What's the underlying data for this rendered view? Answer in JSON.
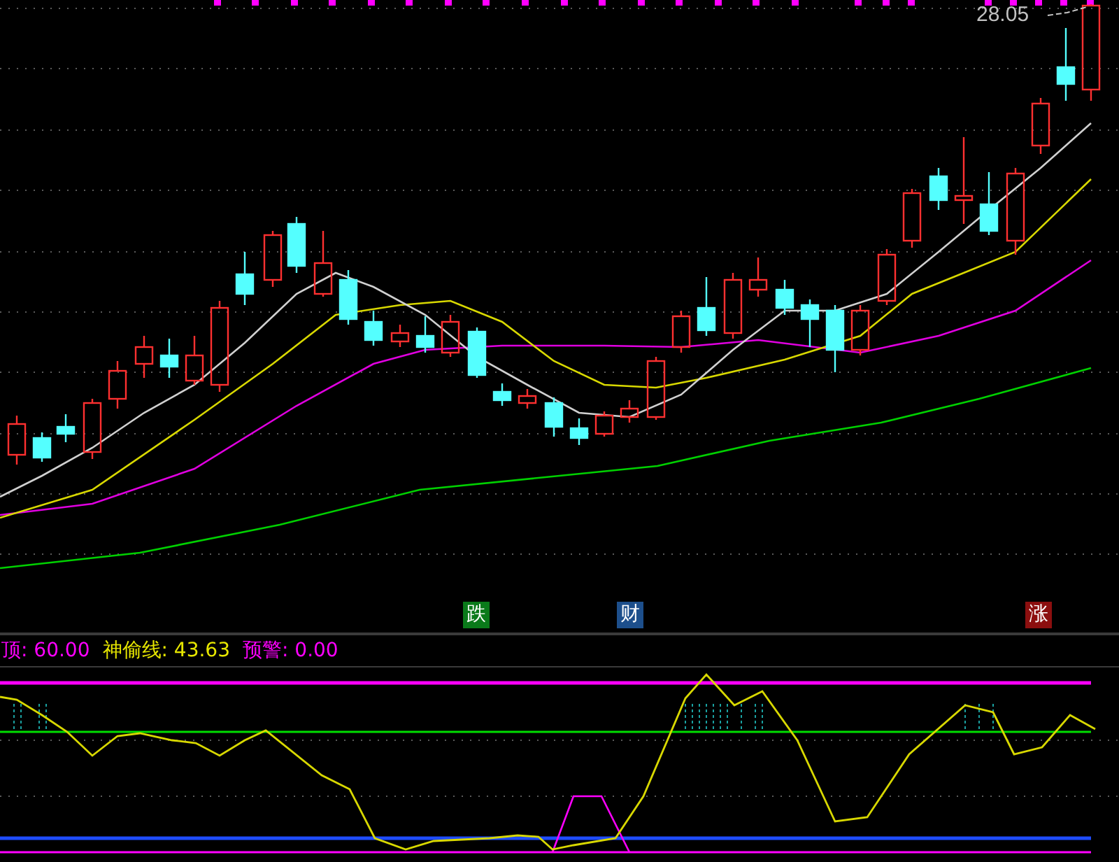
{
  "price_chart": {
    "high_label": "28.05",
    "signals": [
      {
        "label": "跌",
        "color": "#0a7a1a"
      },
      {
        "label": "财",
        "color": "#1d4f8c"
      },
      {
        "label": "涨",
        "color": "#8c0f0f"
      }
    ]
  },
  "indicator": {
    "readings": [
      {
        "text": "顶: 60.00",
        "color": "#ff00ff"
      },
      {
        "text": "神偷线: 43.63",
        "color": "#e6e600"
      },
      {
        "text": "预警: 0.00",
        "color": "#ff00ff"
      }
    ]
  }
}
